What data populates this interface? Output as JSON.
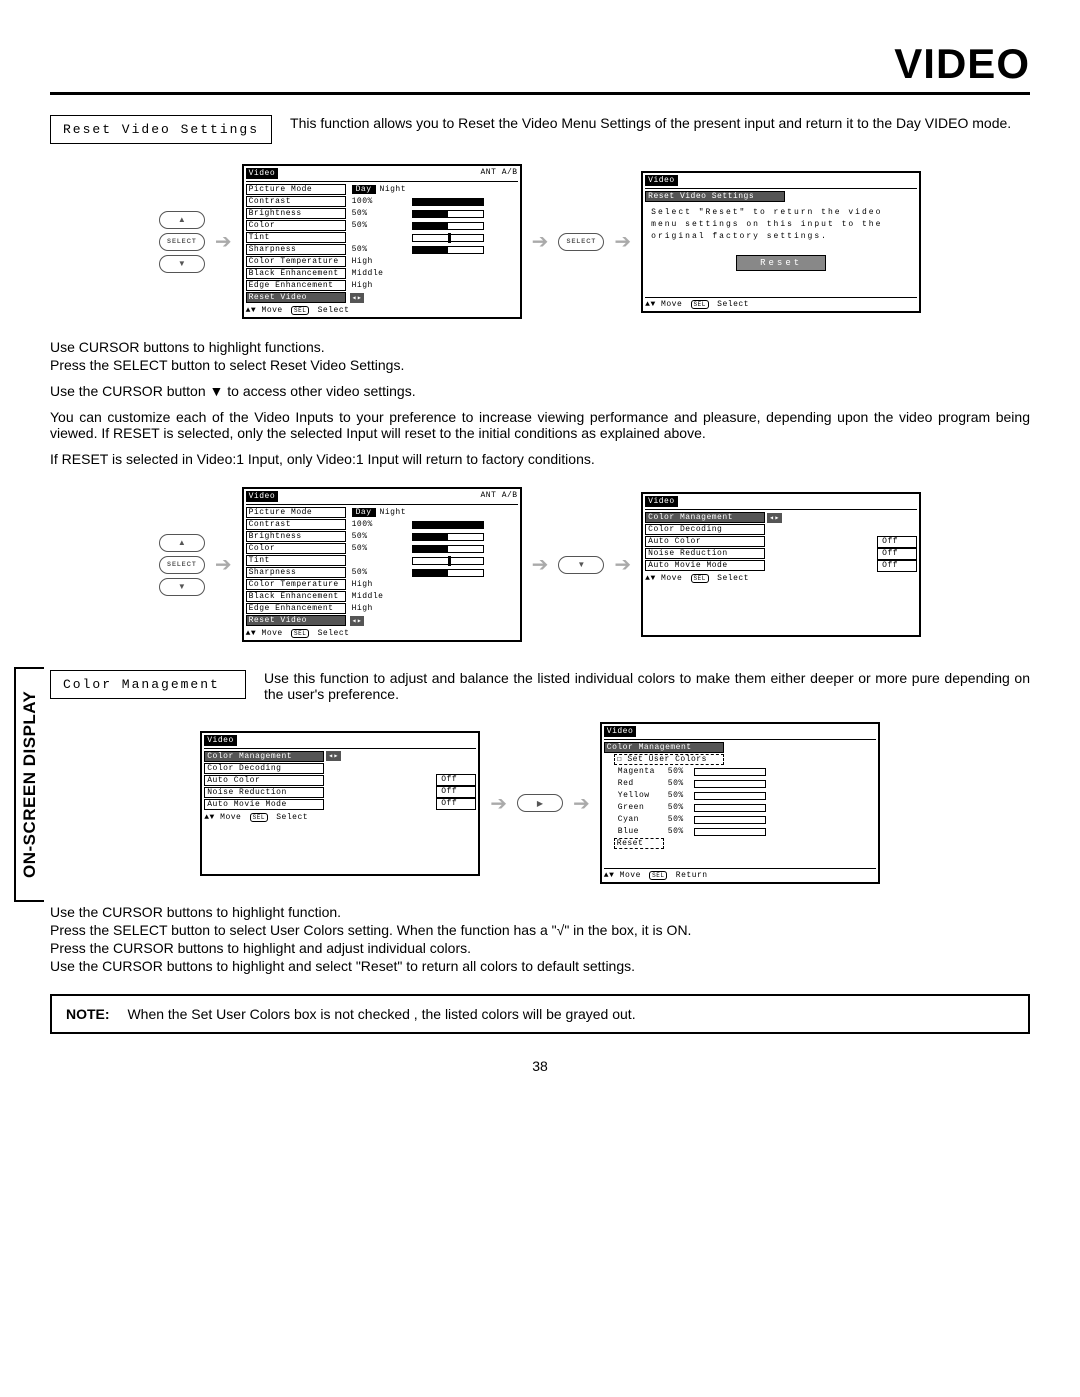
{
  "page_title": "VIDEO",
  "side_tab": "ON-SCREEN DISPLAY",
  "page_number": "38",
  "sections": {
    "reset_video": {
      "label": "Reset Video Settings",
      "desc": "This function allows you to Reset the Video Menu Settings of the present input and return it to the Day VIDEO mode."
    },
    "color_mgmt": {
      "label": "Color Management",
      "desc": "Use this function to adjust and balance the listed individual colors to make them either deeper or more pure depending on the user's preference."
    }
  },
  "instructions": {
    "r1": "Use CURSOR buttons to highlight functions.",
    "r2": "Press the SELECT button to select Reset Video Settings.",
    "r3": "Use the CURSOR button ▼ to access other video settings.",
    "r4": "You can customize each of the Video Inputs to your preference to increase viewing performance and pleasure, depending upon the video program being viewed. If RESET is selected, only the selected Input will reset to the initial conditions as explained above.",
    "r5": "If RESET is selected in Video:1 Input, only Video:1 Input will return to factory conditions.",
    "c1": "Use the CURSOR buttons to highlight function.",
    "c2": "Press the SELECT button to select User Colors setting.  When the function has a \"√\" in the box, it is ON.",
    "c3": "Press  the CURSOR buttons to highlight and adjust individual colors.",
    "c4": "Use the CURSOR buttons to highlight and select \"Reset\" to return all colors to default settings."
  },
  "note": {
    "label": "NOTE:",
    "text": "When the Set User Colors box is not checked , the listed colors will be grayed out."
  },
  "osd": {
    "video_title": "Video",
    "source": "ANT A/B",
    "reset_title": "Reset Video Settings",
    "reset_text": "Select \"Reset\" to return the video menu settings on this input to the original factory settings.",
    "reset_btn": "Reset",
    "footer_move": "Move",
    "footer_sel": "Select",
    "footer_ret": "Return",
    "sel_badge": "SEL",
    "day": "Day",
    "night": "Night",
    "rows": [
      {
        "label": "Picture Mode",
        "type": "daynight"
      },
      {
        "label": "Contrast",
        "type": "bar",
        "val": "100%",
        "pct": 100
      },
      {
        "label": "Brightness",
        "type": "bar",
        "val": "50%",
        "pct": 50
      },
      {
        "label": "Color",
        "type": "bar",
        "val": "50%",
        "pct": 50
      },
      {
        "label": "Tint",
        "type": "marker",
        "val": "",
        "pct": 50
      },
      {
        "label": "Sharpness",
        "type": "bar",
        "val": "50%",
        "pct": 50
      },
      {
        "label": "Color Temperature",
        "type": "text",
        "val": "High"
      },
      {
        "label": "Black Enhancement",
        "type": "text",
        "val": "Middle"
      },
      {
        "label": "Edge Enhancement",
        "type": "text",
        "val": "High"
      },
      {
        "label": "Reset Video Settings",
        "type": "selected"
      }
    ],
    "cm_header": "Color Management",
    "cm_rows": [
      {
        "label": "Color Management",
        "selected": true,
        "arrows": true
      },
      {
        "label": "Color Decoding"
      },
      {
        "label": "Auto Color",
        "box": "Off"
      },
      {
        "label": "Noise Reduction",
        "box": "Off"
      },
      {
        "label": "Auto Movie Mode",
        "box": "Off"
      }
    ],
    "user_colors_label": "Set User Colors",
    "colors": [
      {
        "name": "Magenta",
        "val": "50%"
      },
      {
        "name": "Red",
        "val": "50%"
      },
      {
        "name": "Yellow",
        "val": "50%"
      },
      {
        "name": "Green",
        "val": "50%"
      },
      {
        "name": "Cyan",
        "val": "50%"
      },
      {
        "name": "Blue",
        "val": "50%"
      }
    ],
    "reset_item": "Reset"
  },
  "remote": {
    "up": "▲",
    "down": "▼",
    "right": "▶",
    "select": "SELECT"
  }
}
